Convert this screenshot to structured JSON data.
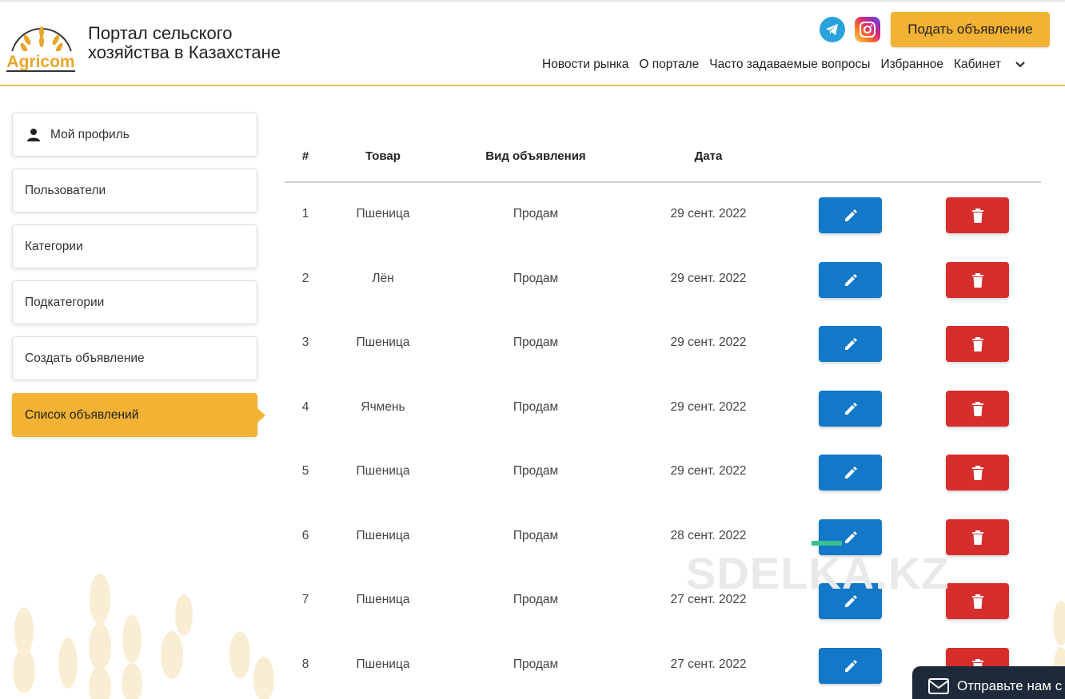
{
  "header": {
    "site_title_line1": "Портал сельского",
    "site_title_line2": "хозяйства в Казахстане",
    "logo_text": "Agricom",
    "cta_label": "Подать объявление",
    "nav": [
      "Новости рынка",
      "О портале",
      "Часто задаваемые вопросы",
      "Избранное",
      "Кабинет"
    ],
    "icons": [
      "telegram-icon",
      "instagram-icon",
      "chevron-down-icon"
    ]
  },
  "sidebar": {
    "items": [
      {
        "label": "Мой профиль",
        "icon": "person-icon",
        "active": false
      },
      {
        "label": "Пользователи",
        "active": false
      },
      {
        "label": "Категории",
        "active": false
      },
      {
        "label": "Подкатегории",
        "active": false
      },
      {
        "label": "Создать объявление",
        "active": false
      },
      {
        "label": "Список объявлений",
        "active": true
      }
    ]
  },
  "table": {
    "headers": [
      "#",
      "Товар",
      "Вид объявления",
      "Дата"
    ],
    "rows": [
      {
        "num": "1",
        "product": "Пшеница",
        "type": "Продам",
        "date": "29 сент. 2022"
      },
      {
        "num": "2",
        "product": "Лён",
        "type": "Продам",
        "date": "29 сент. 2022"
      },
      {
        "num": "3",
        "product": "Пшеница",
        "type": "Продам",
        "date": "29 сент. 2022"
      },
      {
        "num": "4",
        "product": "Ячмень",
        "type": "Продам",
        "date": "29 сент. 2022"
      },
      {
        "num": "5",
        "product": "Пшеница",
        "type": "Продам",
        "date": "29 сент. 2022"
      },
      {
        "num": "6",
        "product": "Пшеница",
        "type": "Продам",
        "date": "28 сент. 2022"
      },
      {
        "num": "7",
        "product": "Пшеница",
        "type": "Продам",
        "date": "27 сент. 2022"
      },
      {
        "num": "8",
        "product": "Пшеница",
        "type": "Продам",
        "date": "27 сент. 2022"
      }
    ],
    "row_icons": [
      "pencil-icon",
      "trash-icon"
    ]
  },
  "watermark": "SDELKA.KZ",
  "chat_widget": {
    "label": "Отправьте нам с",
    "icon": "envelope-icon"
  },
  "colors": {
    "accent": "#f2b233",
    "edit": "#1278c7",
    "delete": "#d62d2d"
  }
}
